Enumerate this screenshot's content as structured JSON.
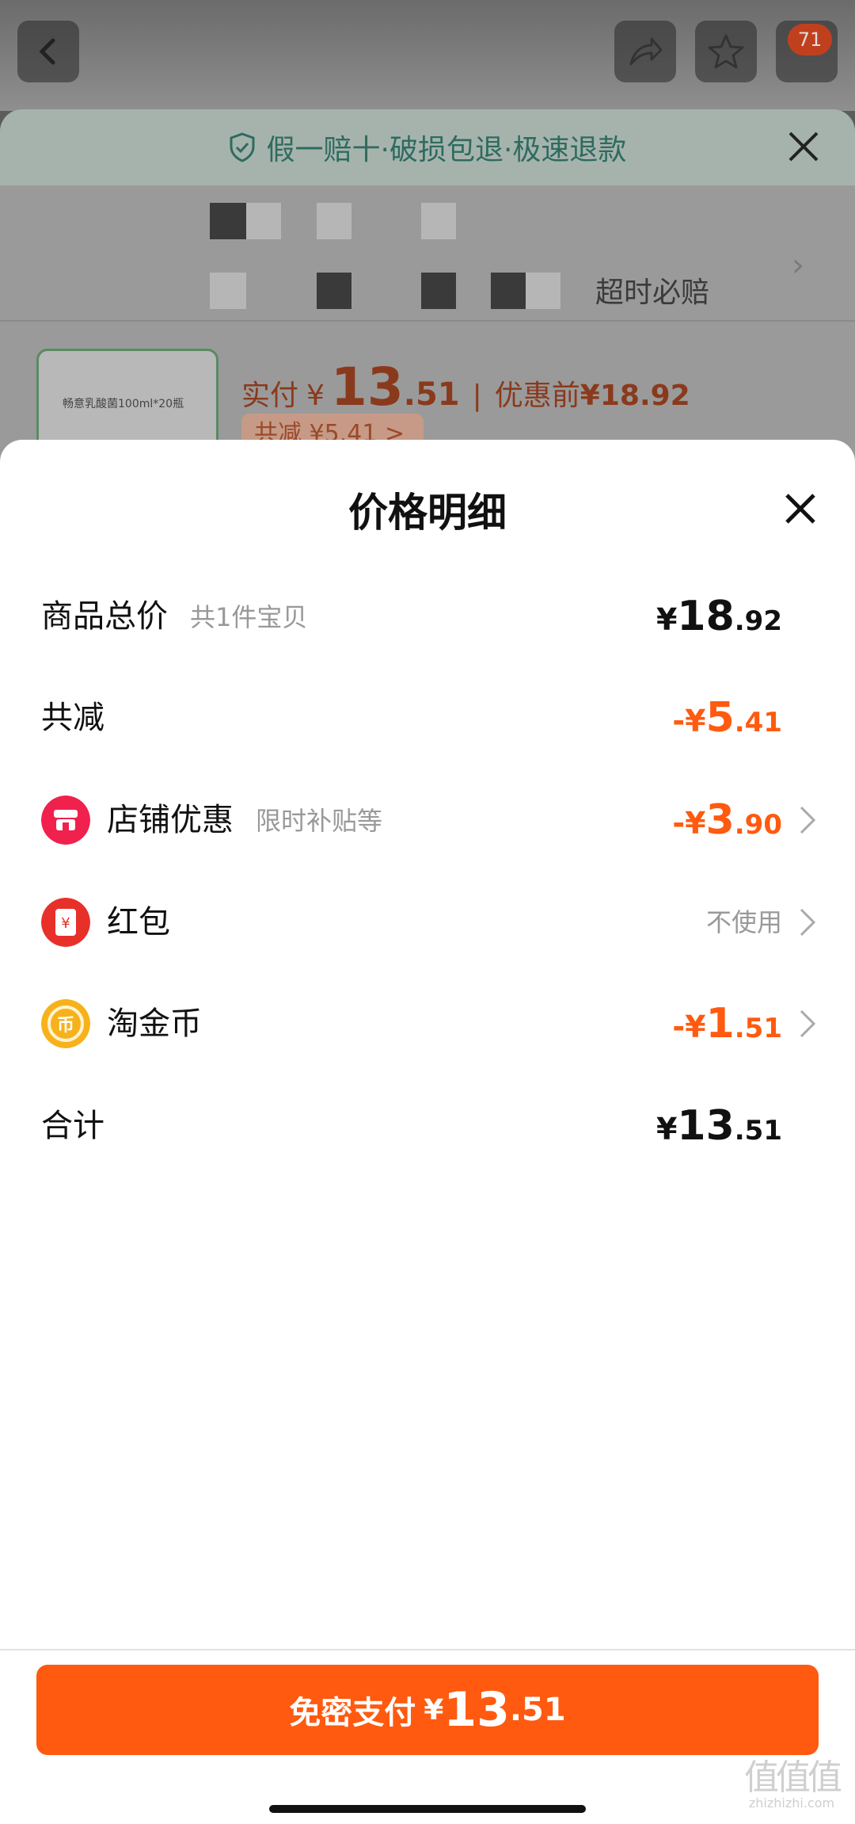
{
  "background": {
    "cart_badge": "71",
    "guarantee": "假一赔十·破损包退·极速退款",
    "timeout_text": "超时必赔",
    "price_row": {
      "label": "实付",
      "currency": "¥",
      "int": "13",
      "dec": ".51",
      "before_label": "优惠前",
      "before_price": "¥18.92"
    },
    "discount_chip": "共减 ¥5.41 >",
    "product_tag": "畅意乳酸菌100ml*20瓶"
  },
  "sheet": {
    "title": "价格明细",
    "rows": [
      {
        "label": "商品总价",
        "sub": "共1件宝贝",
        "currency": "¥",
        "int": "18",
        "dec": ".92"
      },
      {
        "label": "共减",
        "currency": "-¥",
        "int": "5",
        "dec": ".41"
      },
      {
        "label": "店铺优惠",
        "sub": "限时补贴等",
        "currency": "-¥",
        "int": "3",
        "dec": ".90",
        "icon": "store-icon"
      },
      {
        "label": "红包",
        "status": "不使用",
        "icon": "red-packet-icon"
      },
      {
        "label": "淘金币",
        "currency": "-¥",
        "int": "1",
        "dec": ".51",
        "icon": "coin-icon"
      },
      {
        "label": "合计",
        "currency": "¥",
        "int": "13",
        "dec": ".51"
      }
    ]
  },
  "pay_button": {
    "label": "免密支付",
    "currency": "¥",
    "int": "13",
    "dec": ".51"
  },
  "watermark": {
    "mark": "值值值",
    "url": "zhizhizhi.com"
  },
  "colors": {
    "accent": "#ff5a0f",
    "store_icon": "#f0214d",
    "red_packet_icon": "#e8302a",
    "coin_icon": "#f7b21b"
  }
}
